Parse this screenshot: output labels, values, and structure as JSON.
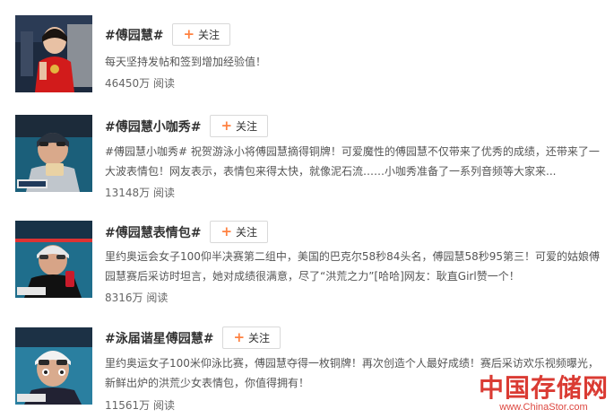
{
  "topics": [
    {
      "title": "#傅园慧#",
      "follow_label": "关注",
      "description": "每天坚持发帖和签到增加经验值！",
      "reads": "46450万 阅读"
    },
    {
      "title": "#傅园慧小咖秀#",
      "follow_label": "关注",
      "description": "#傅园慧小咖秀# 祝贺游泳小将傅园慧摘得铜牌！可爱魔性的傅园慧不仅带来了优秀的成绩，还带来了一大波表情包！网友表示，表情包来得太快，就像泥石流……小咖秀准备了一系列音频等大家来...",
      "reads": "13148万 阅读"
    },
    {
      "title": "#傅园慧表情包#",
      "follow_label": "关注",
      "description": "里约奥运会女子100仰半决赛第二组中，美国的巴克尔58秒84头名，傅园慧58秒95第三！可爱的姑娘傅园慧赛后采访时坦言，她对成绩很满意，尽了“洪荒之力”[哈哈]网友：耿直Girl赞一个！",
      "reads": "8316万 阅读"
    },
    {
      "title": "#泳届谐星傅园慧#",
      "follow_label": "关注",
      "description": "里约奥运女子100米仰泳比赛，傅园慧夺得一枚铜牌！再次创造个人最好成绩！赛后采访欢乐视频曝光，新鲜出炉的洪荒少女表情包，你值得拥有！",
      "reads": "11561万 阅读"
    }
  ],
  "watermark": {
    "name": "中国存储网",
    "url": "www.ChinaStor.com"
  },
  "colors": {
    "accent_plus": "#ff8140",
    "watermark": "#d7261e"
  }
}
